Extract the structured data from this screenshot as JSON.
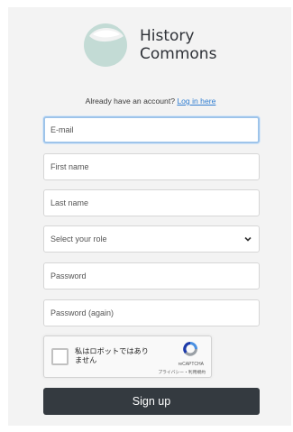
{
  "brand": {
    "line1": "History",
    "line2": "Commons"
  },
  "login_prompt": {
    "text": "Already have an account?",
    "link": "Log in here"
  },
  "form": {
    "email_placeholder": "E-mail",
    "first_name_placeholder": "First name",
    "last_name_placeholder": "Last name",
    "role_selected": "Select your role",
    "password_placeholder": "Password",
    "password_again_placeholder": "Password (again)",
    "submit_label": "Sign up"
  },
  "captcha": {
    "label": "私はロボットではありません",
    "brand": "reCAPTCHA",
    "links": "プライバシー・利用規約"
  },
  "colors": {
    "page_bg": "#ffffff",
    "card_bg": "#f3f3f3",
    "button_bg": "#343a40",
    "link": "#2f7dd1",
    "focus_ring": "#9ec4ea"
  },
  "icons": {
    "logo": "history-commons-logo",
    "select": "chevron-down-icon",
    "captcha": "recaptcha-logo-icon"
  }
}
